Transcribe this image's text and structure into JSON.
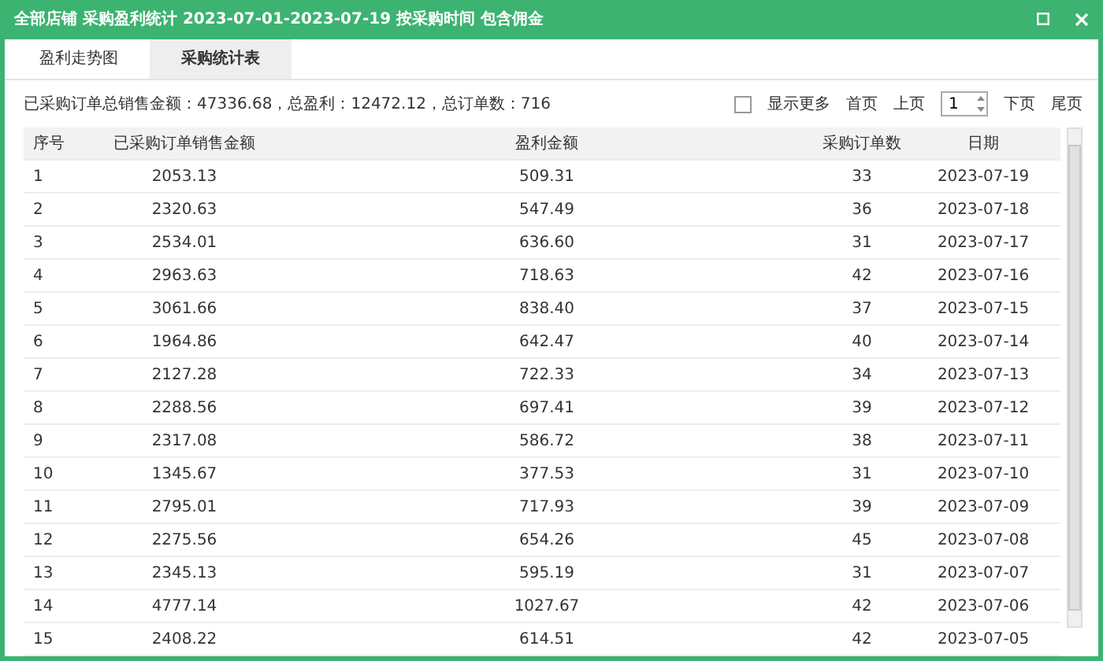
{
  "window": {
    "title": "全部店铺 采购盈利统计 2023-07-01-2023-07-19 按采购时间 包含佣金"
  },
  "tabs": [
    {
      "label": "盈利走势图",
      "selected": false
    },
    {
      "label": "采购统计表",
      "selected": true
    }
  ],
  "summary": "已采购订单总销售金额：47336.68，总盈利：12472.12，总订单数：716",
  "pager": {
    "show_more": {
      "label": "显示更多",
      "checked": false
    },
    "first": "首页",
    "prev": "上页",
    "page": "1",
    "next": "下页",
    "last": "尾页"
  },
  "table": {
    "columns": [
      "序号",
      "已采购订单销售金额",
      "盈利金额",
      "采购订单数",
      "日期"
    ],
    "rows": [
      [
        "1",
        "2053.13",
        "509.31",
        "33",
        "2023-07-19"
      ],
      [
        "2",
        "2320.63",
        "547.49",
        "36",
        "2023-07-18"
      ],
      [
        "3",
        "2534.01",
        "636.60",
        "31",
        "2023-07-17"
      ],
      [
        "4",
        "2963.63",
        "718.63",
        "42",
        "2023-07-16"
      ],
      [
        "5",
        "3061.66",
        "838.40",
        "37",
        "2023-07-15"
      ],
      [
        "6",
        "1964.86",
        "642.47",
        "40",
        "2023-07-14"
      ],
      [
        "7",
        "2127.28",
        "722.33",
        "34",
        "2023-07-13"
      ],
      [
        "8",
        "2288.56",
        "697.41",
        "39",
        "2023-07-12"
      ],
      [
        "9",
        "2317.08",
        "586.72",
        "38",
        "2023-07-11"
      ],
      [
        "10",
        "1345.67",
        "377.53",
        "31",
        "2023-07-10"
      ],
      [
        "11",
        "2795.01",
        "717.93",
        "39",
        "2023-07-09"
      ],
      [
        "12",
        "2275.56",
        "654.26",
        "45",
        "2023-07-08"
      ],
      [
        "13",
        "2345.13",
        "595.19",
        "31",
        "2023-07-07"
      ],
      [
        "14",
        "4777.14",
        "1027.67",
        "42",
        "2023-07-06"
      ],
      [
        "15",
        "2408.22",
        "614.51",
        "42",
        "2023-07-05"
      ]
    ]
  }
}
